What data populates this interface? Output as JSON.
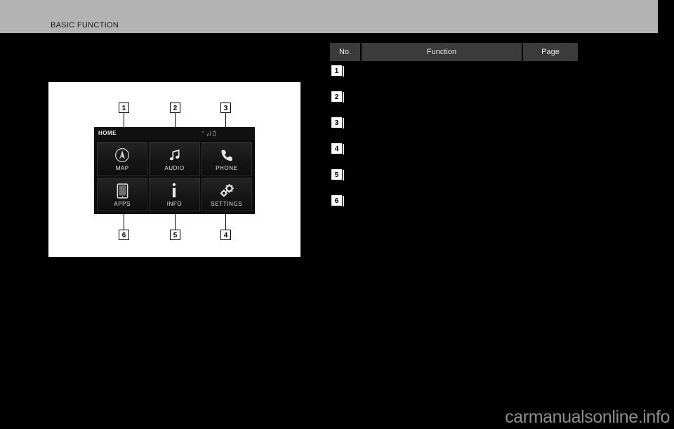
{
  "header": {
    "title": "BASIC FUNCTION"
  },
  "figure": {
    "head_unit": {
      "status_label": "HOME",
      "status_icons": [
        "bluetooth-icon",
        "signal-bars-icon",
        "battery-icon"
      ],
      "tiles": [
        {
          "label": "MAP",
          "icon": "navigation-compass-icon"
        },
        {
          "label": "AUDIO",
          "icon": "music-note-icon"
        },
        {
          "label": "PHONE",
          "icon": "phone-handset-icon"
        },
        {
          "label": "APPS",
          "icon": "tablet-device-icon"
        },
        {
          "label": "INFO",
          "icon": "information-icon"
        },
        {
          "label": "SETTINGS",
          "icon": "gears-icon"
        }
      ]
    },
    "callouts_top": [
      "1",
      "2",
      "3"
    ],
    "callouts_bottom": [
      "6",
      "5",
      "4"
    ]
  },
  "table": {
    "columns": [
      "No.",
      "Function",
      "Page"
    ],
    "rows": [
      {
        "no": "1",
        "function": "",
        "page": ""
      },
      {
        "no": "2",
        "function": "",
        "page": ""
      },
      {
        "no": "3",
        "function": "",
        "page": ""
      },
      {
        "no": "4",
        "function": "",
        "page": ""
      },
      {
        "no": "5",
        "function": "",
        "page": ""
      },
      {
        "no": "6",
        "function": "",
        "page": ""
      }
    ]
  },
  "watermark": {
    "text": "carmanualsonline.info"
  },
  "colors": {
    "header_band": "#b3b3b3",
    "page_background": "#000000",
    "table_header": "#3b3b3b",
    "figure_plate": "#ffffff",
    "watermark": "#8d8d8d"
  }
}
